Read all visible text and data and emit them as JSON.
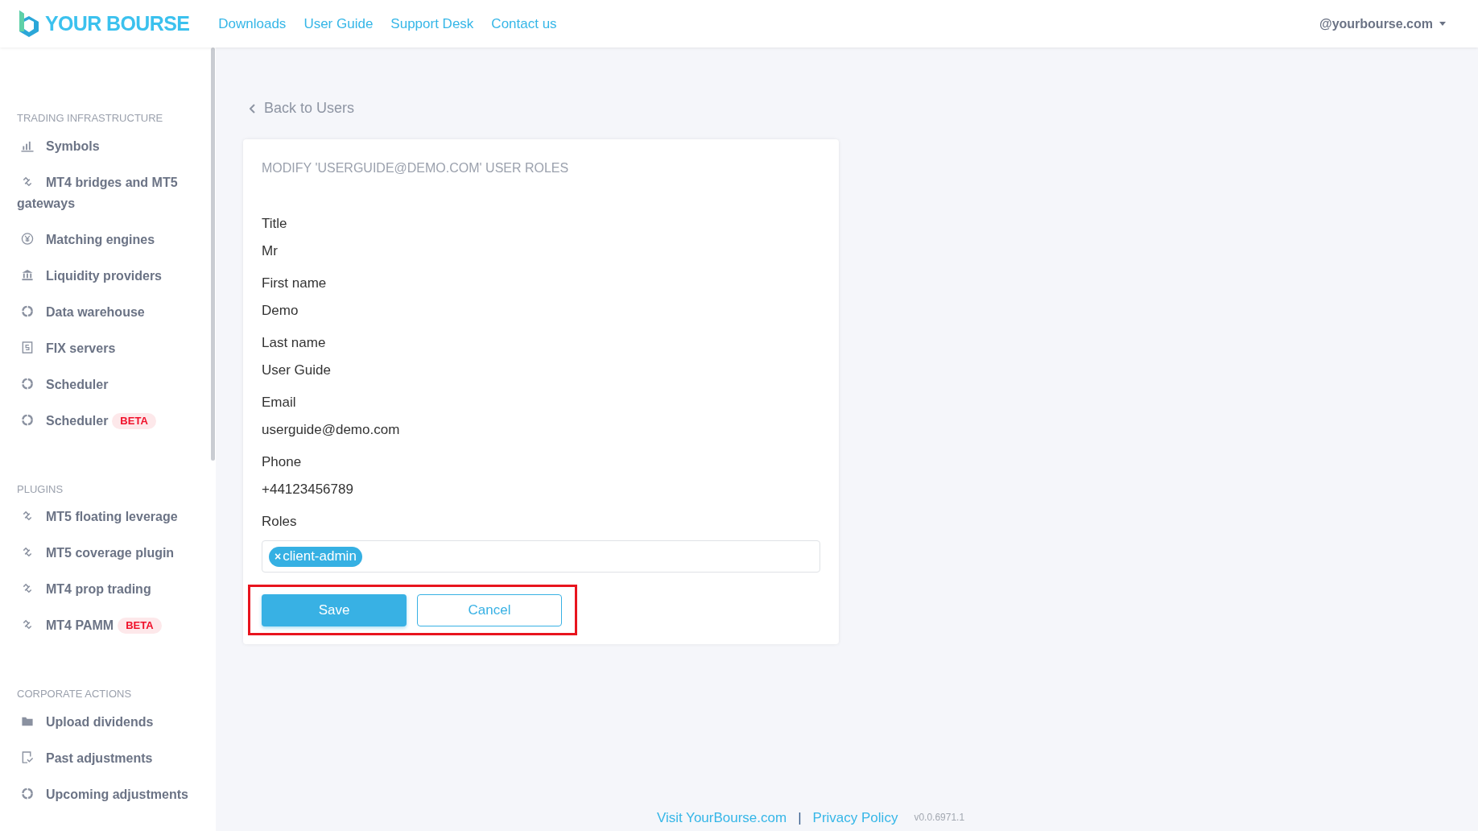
{
  "header": {
    "logo": "YOUR BOURSE",
    "nav": [
      "Downloads",
      "User Guide",
      "Support Desk",
      "Contact us"
    ],
    "account": "@yourbourse.com"
  },
  "sidebar": {
    "sections": [
      {
        "title": "TRADING INFRASTRUCTURE",
        "items": [
          {
            "label": "Symbols"
          },
          {
            "label": "MT4 bridges and MT5 gateways"
          },
          {
            "label": "Matching engines"
          },
          {
            "label": "Liquidity providers"
          },
          {
            "label": "Data warehouse"
          },
          {
            "label": "FIX servers"
          },
          {
            "label": "Scheduler"
          },
          {
            "label": "Scheduler",
            "badge": "BETA"
          }
        ]
      },
      {
        "title": "PLUGINS",
        "items": [
          {
            "label": "MT5 floating leverage"
          },
          {
            "label": "MT5 coverage plugin"
          },
          {
            "label": "MT4 prop trading"
          },
          {
            "label": "MT4 PAMM",
            "badge": "BETA"
          }
        ]
      },
      {
        "title": "CORPORATE ACTIONS",
        "items": [
          {
            "label": "Upload dividends"
          },
          {
            "label": "Past adjustments"
          },
          {
            "label": "Upcoming adjustments"
          }
        ]
      }
    ]
  },
  "back_link": "Back to Users",
  "form": {
    "title": "MODIFY 'USERGUIDE@DEMO.COM' USER ROLES",
    "fields": [
      {
        "label": "Title",
        "value": "Mr"
      },
      {
        "label": "First name",
        "value": "Demo"
      },
      {
        "label": "Last name",
        "value": "User Guide"
      },
      {
        "label": "Email",
        "value": "userguide@demo.com"
      },
      {
        "label": "Phone",
        "value": "+44123456789"
      }
    ],
    "roles": {
      "label": "Roles",
      "tags": [
        {
          "remove": "×",
          "label": "client-admin"
        }
      ]
    },
    "actions": {
      "highlighted": true,
      "buttons": [
        {
          "label": "Save",
          "kind": "primary"
        },
        {
          "label": "Cancel",
          "kind": "outline"
        }
      ]
    }
  },
  "footer": {
    "links": [
      "Visit YourBourse.com",
      "Privacy Policy"
    ],
    "separator": "|",
    "version": "v0.0.6971.1"
  }
}
